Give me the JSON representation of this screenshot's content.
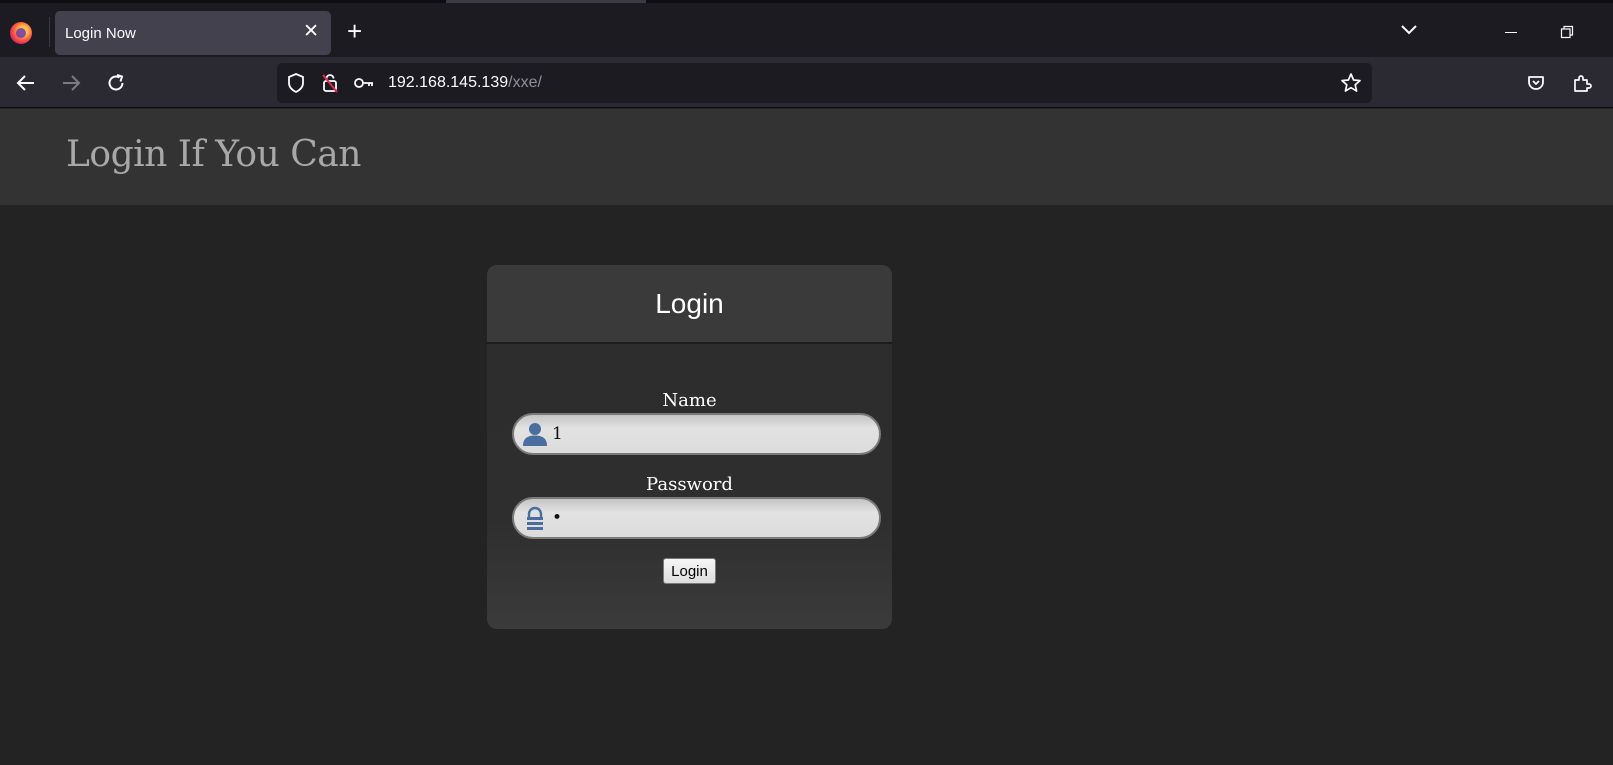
{
  "browser": {
    "tab": {
      "title": "Login Now"
    },
    "address": {
      "host": "192.168.145.139",
      "path": "/xxe/"
    }
  },
  "page": {
    "site_title": "Login If You Can",
    "login_box": {
      "heading": "Login",
      "name_label": "Name",
      "name_value": "1",
      "password_label": "Password",
      "password_value": "•",
      "submit_label": "Login"
    }
  },
  "colors": {
    "page_background": "#232323",
    "header_background": "#333333",
    "field_icon": "#4a6f9e"
  },
  "icons": {
    "name_field": "user-icon",
    "password_field": "lock-icon"
  }
}
